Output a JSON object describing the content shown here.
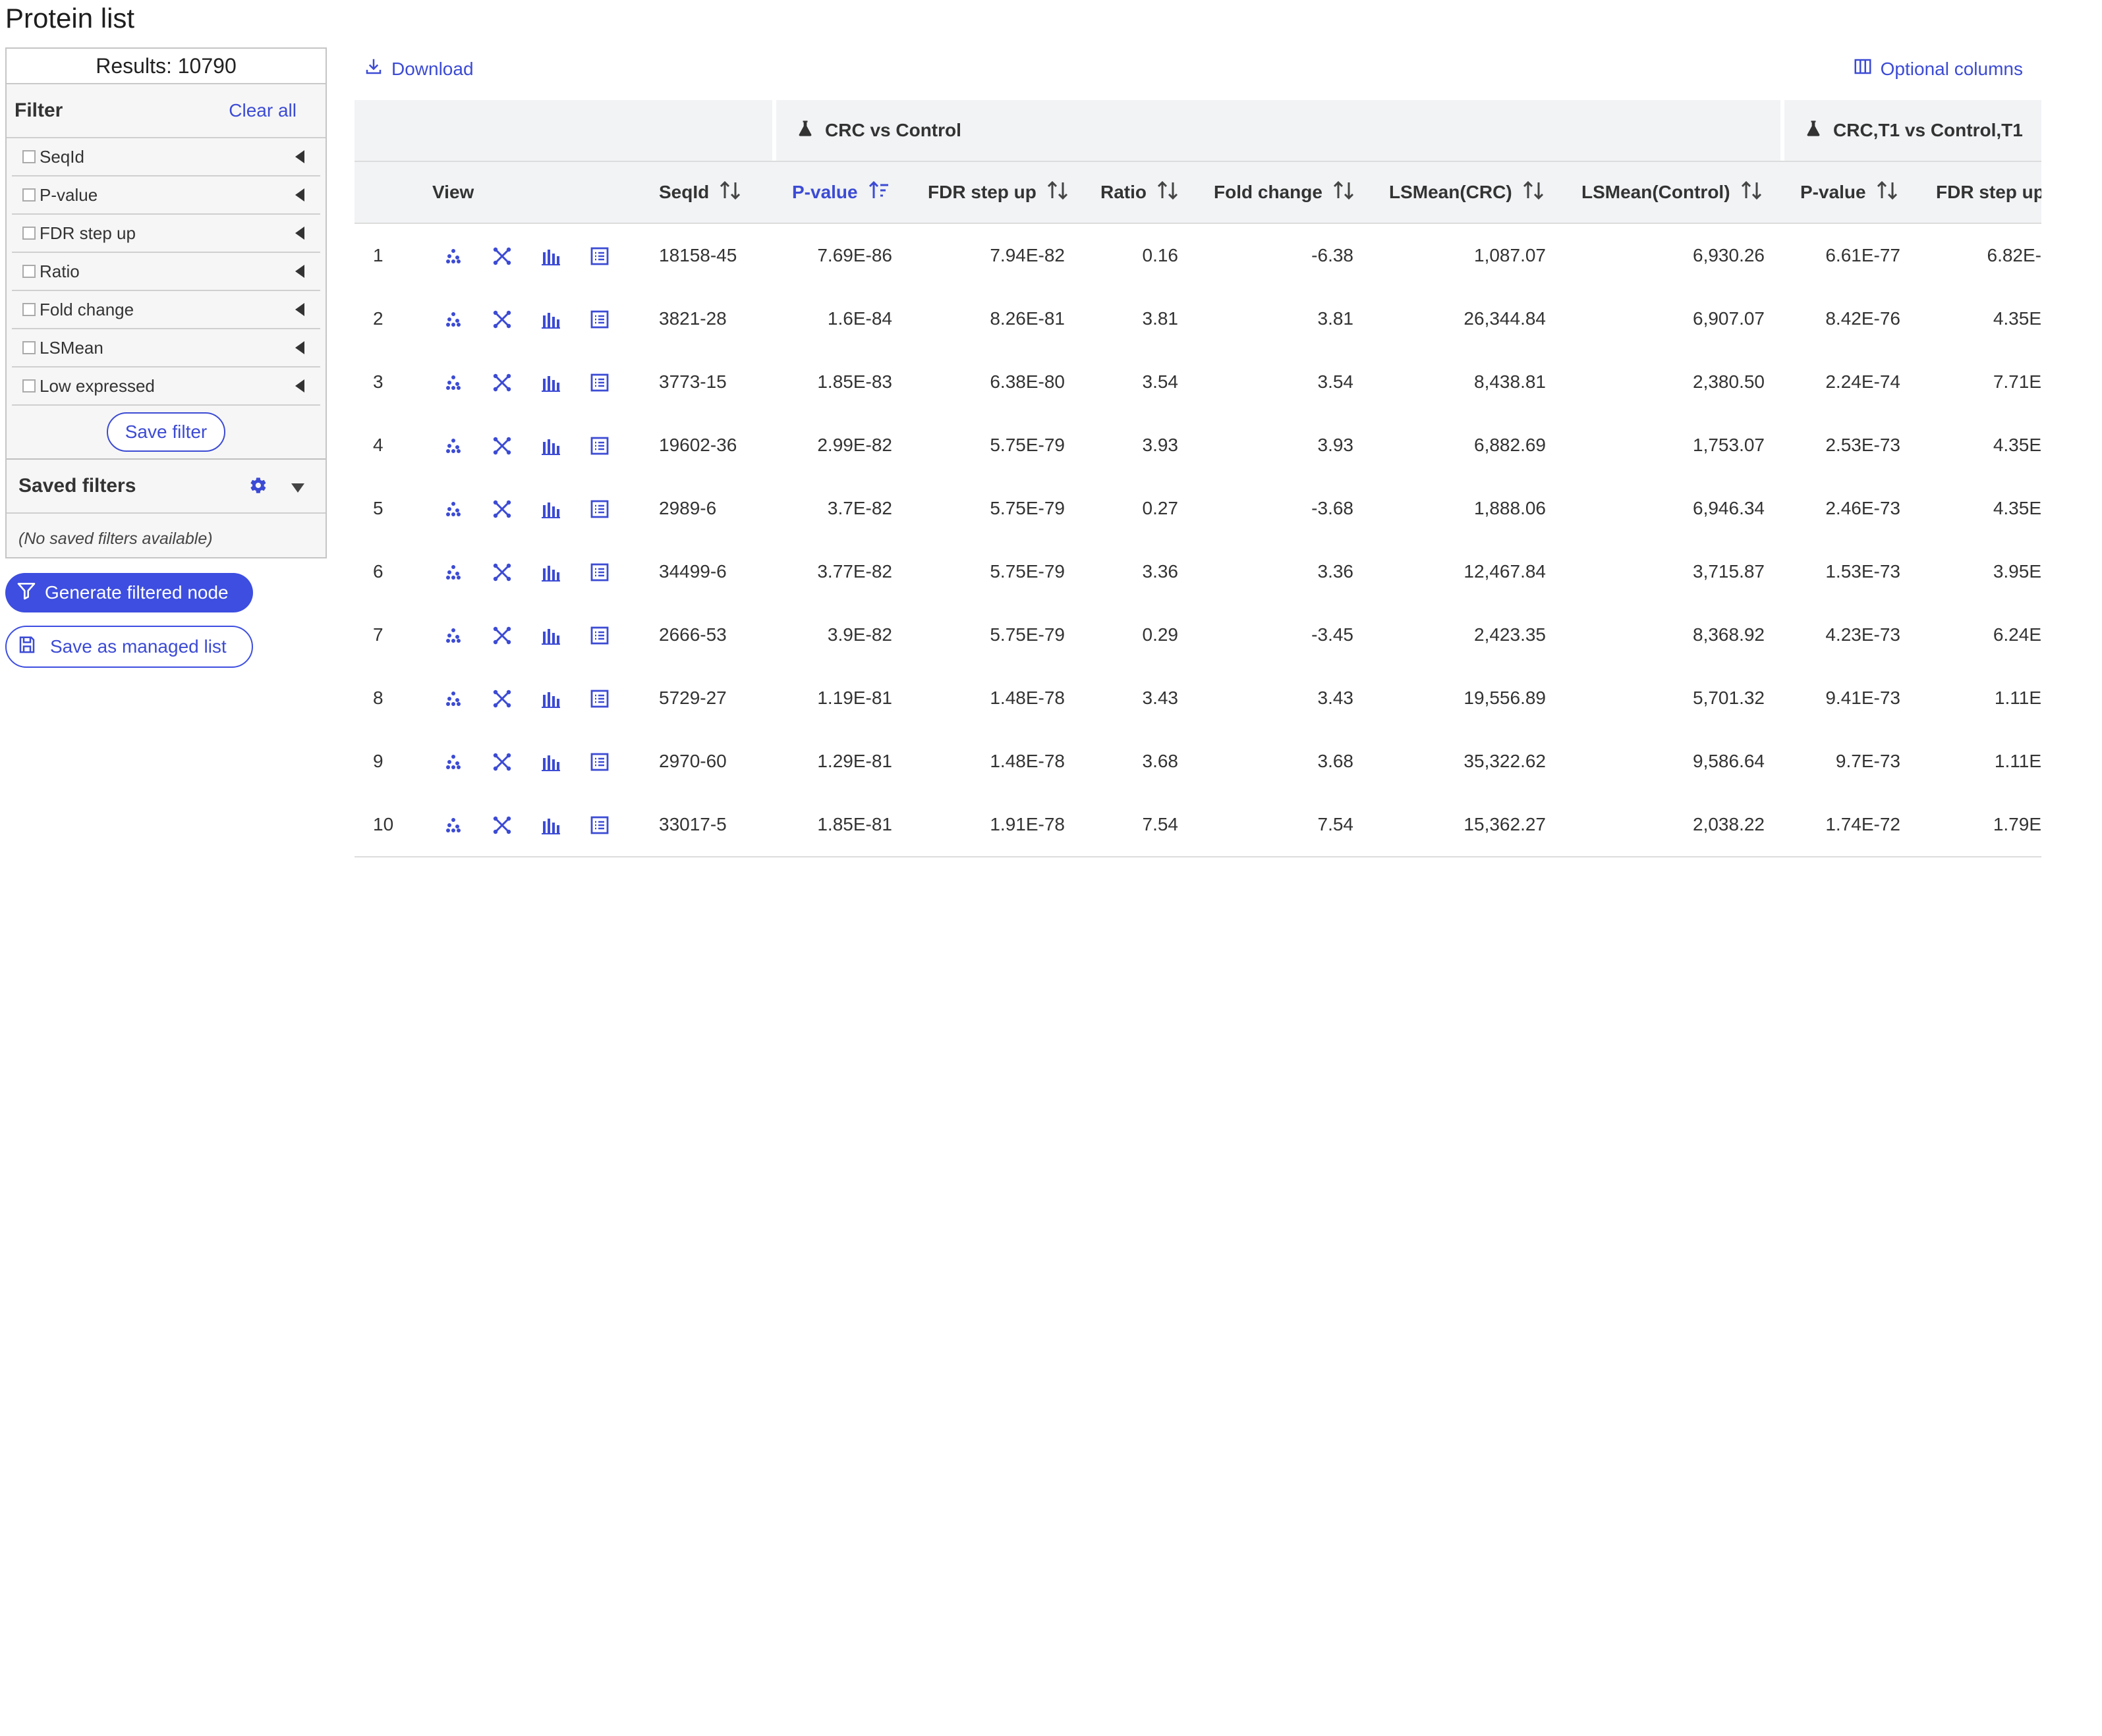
{
  "page": {
    "title": "Protein list"
  },
  "panel": {
    "results": "Results: 10790",
    "filter_label": "Filter",
    "clear_all": "Clear all",
    "filters": [
      "SeqId",
      "P-value",
      "FDR step up",
      "Ratio",
      "Fold change",
      "LSMean",
      "Low expressed"
    ],
    "save_filter": "Save filter",
    "saved_filters_label": "Saved filters",
    "no_saved": "(No saved filters available)"
  },
  "actions": {
    "generate": "Generate filtered node",
    "save_list": "Save as managed list"
  },
  "toolbar": {
    "download": "Download",
    "optional_columns": "Optional columns"
  },
  "table": {
    "groups": [
      "CRC vs Control",
      "CRC,T1 vs Control,T1"
    ],
    "headers": {
      "view": "View",
      "seqid": "SeqId",
      "pvalue": "P-value",
      "fdr": "FDR step up",
      "ratio": "Ratio",
      "fold": "Fold change",
      "lsmean_crc": "LSMean(CRC)",
      "lsmean_ctrl": "LSMean(Control)",
      "pvalue2": "P-value",
      "fdr2": "FDR step up"
    },
    "rows": [
      {
        "n": "1",
        "seqid": "18158-45",
        "pvalue": "7.69E-86",
        "fdr": "7.94E-82",
        "ratio": "0.16",
        "fold": "-6.38",
        "lsmean_crc": "1,087.07",
        "lsmean_ctrl": "6,930.26",
        "pvalue2": "6.61E-77",
        "fdr2": "6.82E-"
      },
      {
        "n": "2",
        "seqid": "3821-28",
        "pvalue": "1.6E-84",
        "fdr": "8.26E-81",
        "ratio": "3.81",
        "fold": "3.81",
        "lsmean_crc": "26,344.84",
        "lsmean_ctrl": "6,907.07",
        "pvalue2": "8.42E-76",
        "fdr2": "4.35E"
      },
      {
        "n": "3",
        "seqid": "3773-15",
        "pvalue": "1.85E-83",
        "fdr": "6.38E-80",
        "ratio": "3.54",
        "fold": "3.54",
        "lsmean_crc": "8,438.81",
        "lsmean_ctrl": "2,380.50",
        "pvalue2": "2.24E-74",
        "fdr2": "7.71E"
      },
      {
        "n": "4",
        "seqid": "19602-36",
        "pvalue": "2.99E-82",
        "fdr": "5.75E-79",
        "ratio": "3.93",
        "fold": "3.93",
        "lsmean_crc": "6,882.69",
        "lsmean_ctrl": "1,753.07",
        "pvalue2": "2.53E-73",
        "fdr2": "4.35E"
      },
      {
        "n": "5",
        "seqid": "2989-6",
        "pvalue": "3.7E-82",
        "fdr": "5.75E-79",
        "ratio": "0.27",
        "fold": "-3.68",
        "lsmean_crc": "1,888.06",
        "lsmean_ctrl": "6,946.34",
        "pvalue2": "2.46E-73",
        "fdr2": "4.35E"
      },
      {
        "n": "6",
        "seqid": "34499-6",
        "pvalue": "3.77E-82",
        "fdr": "5.75E-79",
        "ratio": "3.36",
        "fold": "3.36",
        "lsmean_crc": "12,467.84",
        "lsmean_ctrl": "3,715.87",
        "pvalue2": "1.53E-73",
        "fdr2": "3.95E"
      },
      {
        "n": "7",
        "seqid": "2666-53",
        "pvalue": "3.9E-82",
        "fdr": "5.75E-79",
        "ratio": "0.29",
        "fold": "-3.45",
        "lsmean_crc": "2,423.35",
        "lsmean_ctrl": "8,368.92",
        "pvalue2": "4.23E-73",
        "fdr2": "6.24E"
      },
      {
        "n": "8",
        "seqid": "5729-27",
        "pvalue": "1.19E-81",
        "fdr": "1.48E-78",
        "ratio": "3.43",
        "fold": "3.43",
        "lsmean_crc": "19,556.89",
        "lsmean_ctrl": "5,701.32",
        "pvalue2": "9.41E-73",
        "fdr2": "1.11E"
      },
      {
        "n": "9",
        "seqid": "2970-60",
        "pvalue": "1.29E-81",
        "fdr": "1.48E-78",
        "ratio": "3.68",
        "fold": "3.68",
        "lsmean_crc": "35,322.62",
        "lsmean_ctrl": "9,586.64",
        "pvalue2": "9.7E-73",
        "fdr2": "1.11E"
      },
      {
        "n": "10",
        "seqid": "33017-5",
        "pvalue": "1.85E-81",
        "fdr": "1.91E-78",
        "ratio": "7.54",
        "fold": "7.54",
        "lsmean_crc": "15,362.27",
        "lsmean_ctrl": "2,038.22",
        "pvalue2": "1.74E-72",
        "fdr2": "1.79E"
      }
    ]
  },
  "colors": {
    "accent": "#3c4bd4",
    "button_fill": "#3d4ee0",
    "header_bg": "#f1f3f5"
  },
  "icons": [
    "download-icon",
    "columns-icon",
    "flask-icon",
    "sort-icon",
    "scatter-icon",
    "network-icon",
    "bars-icon",
    "list-icon",
    "gear-icon",
    "filter-icon",
    "save-icon"
  ]
}
